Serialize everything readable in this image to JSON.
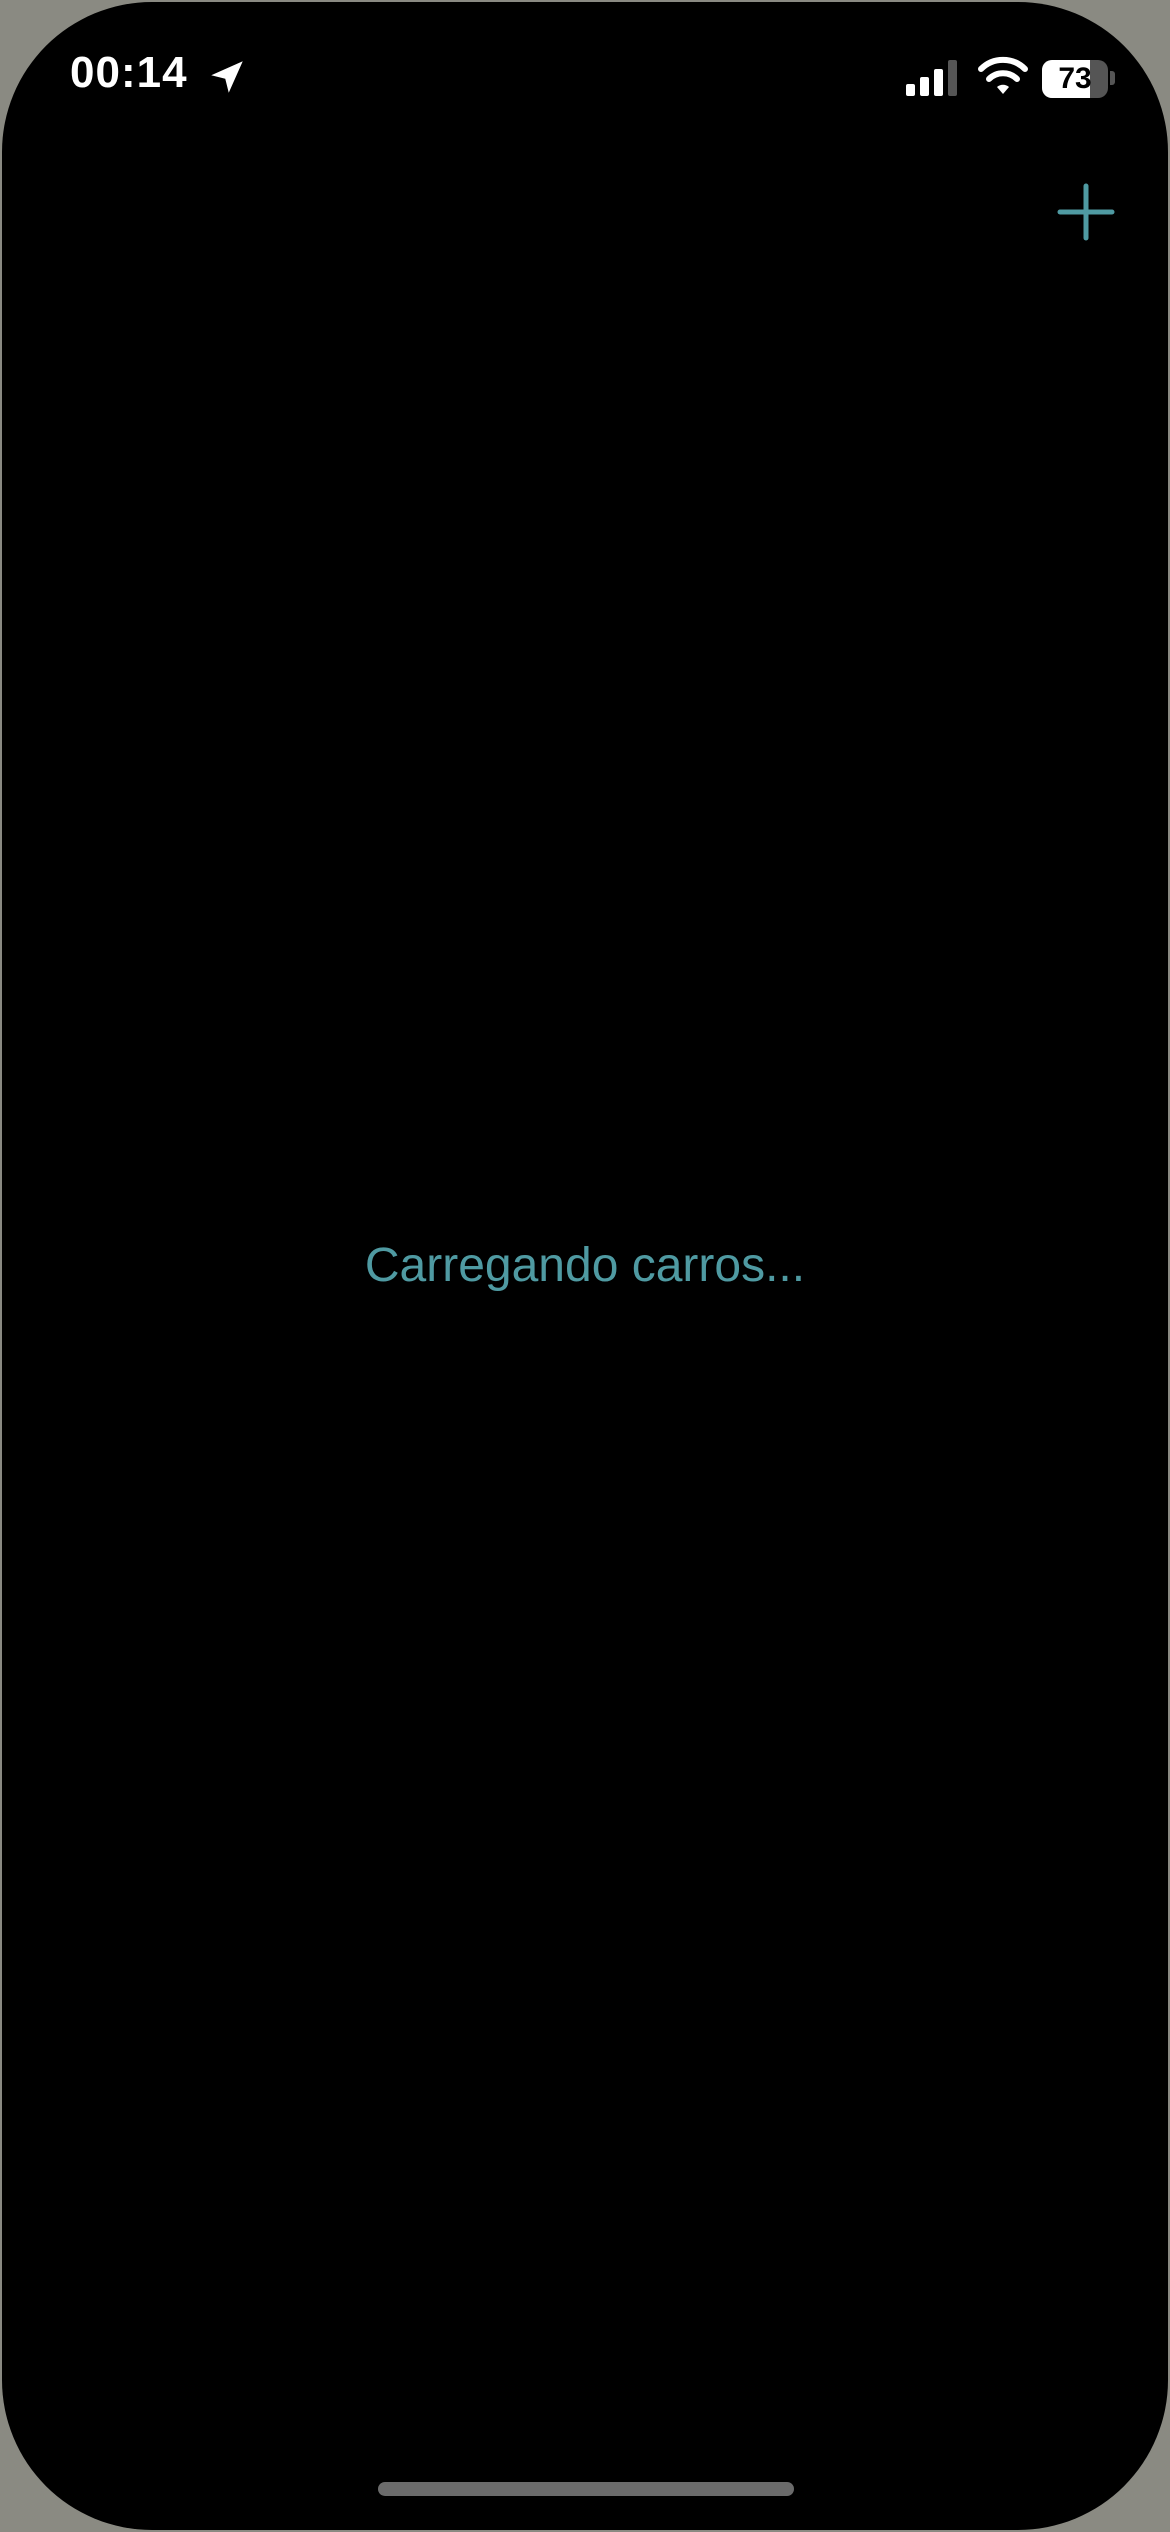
{
  "status_bar": {
    "time": "00:14",
    "battery_level": "73",
    "battery_fraction": 0.73,
    "icons": [
      "location-arrow-icon",
      "cellular-signal-icon",
      "wifi-icon",
      "battery-icon"
    ]
  },
  "toolbar": {
    "add_icon": "plus-icon"
  },
  "main": {
    "loading_text": "Carregando carros..."
  },
  "colors": {
    "background": "#000000",
    "accent": "#4f9aa2",
    "status_text": "#ffffff"
  }
}
